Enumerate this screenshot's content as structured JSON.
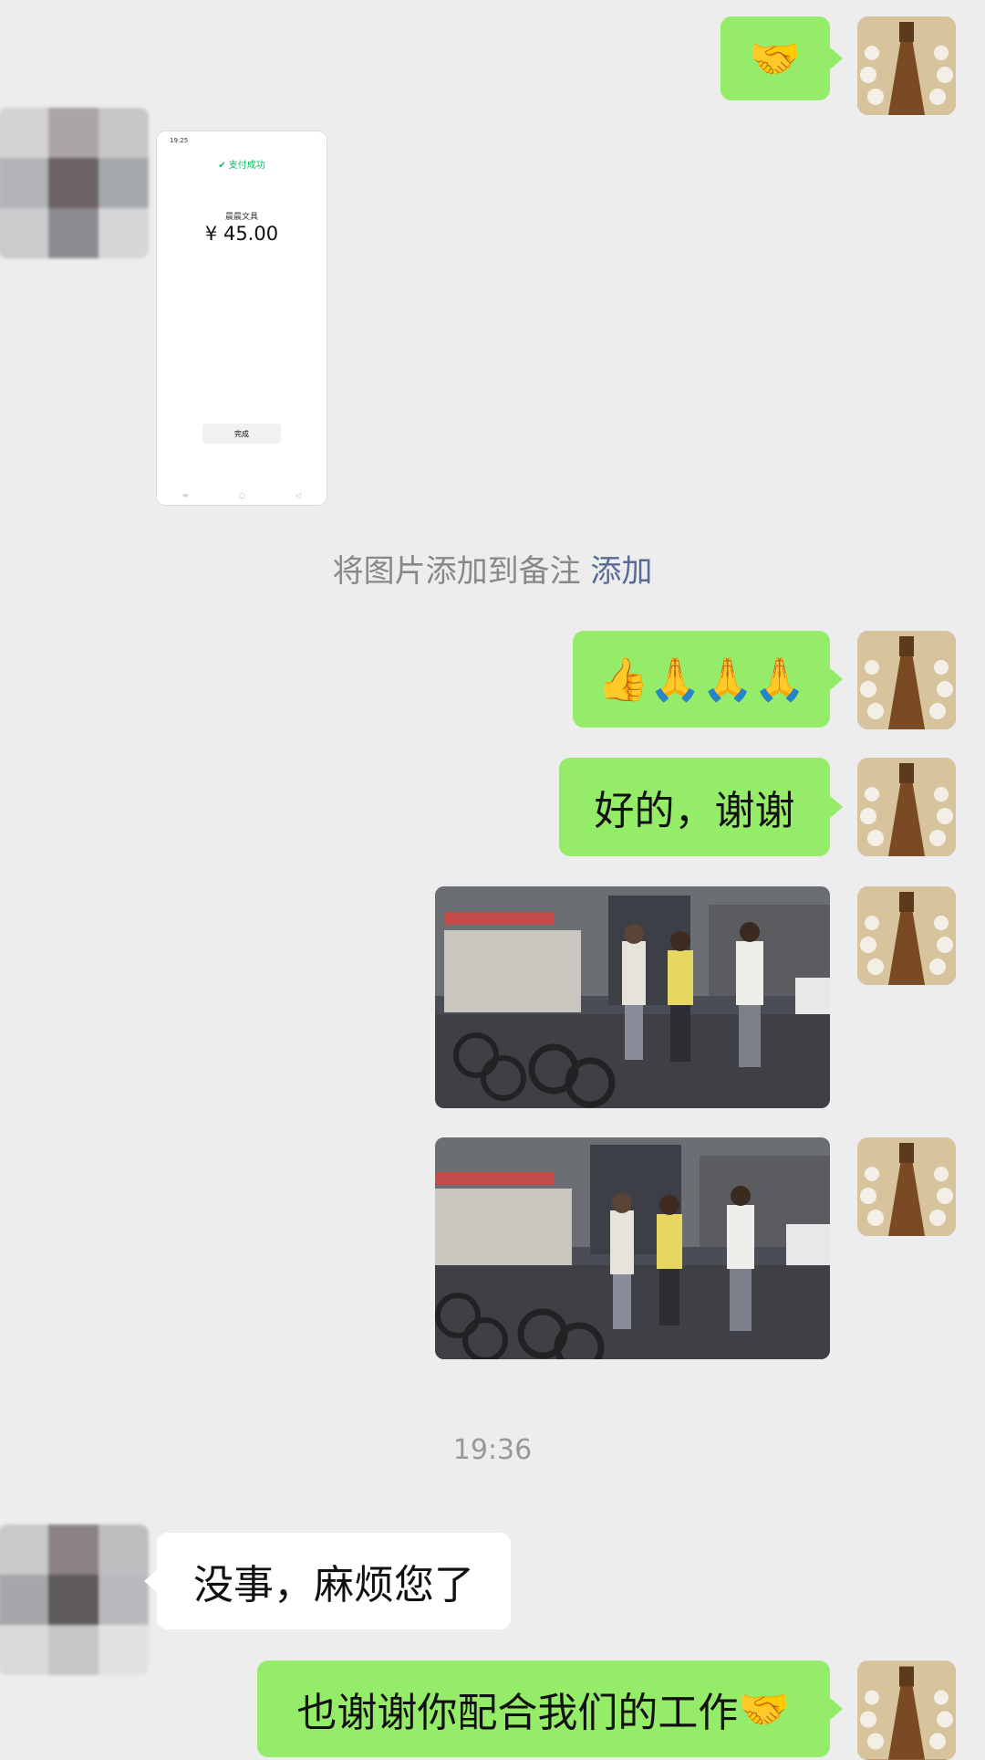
{
  "messages": {
    "m1_emoji": "🤝",
    "payment": {
      "status_time": "19:25",
      "success_label": "支付成功",
      "merchant": "晨晨文具",
      "amount": "¥ 45.00",
      "done_button": "完成",
      "nav_icons": [
        "≡",
        "○",
        "◁"
      ]
    },
    "note_hint": "将图片添加到备注",
    "note_link": "添加",
    "m3_emojis": "👍🙏🙏🙏",
    "m4_text": "好的，谢谢",
    "timestamp": "19:36",
    "m7_text": "没事，麻烦您了",
    "m8_text": "也谢谢你配合我们的工作",
    "m8_emoji": "🤝"
  },
  "colors": {
    "background": "#EDEDED",
    "bubble_self": "#95EC69",
    "bubble_other": "#FFFFFF",
    "link": "#576B95",
    "pay_success": "#07C160"
  },
  "icons": [
    "self-avatar",
    "contact-avatar",
    "check-icon",
    "handshake-emoji",
    "thumbs-up-emoji",
    "praying-hands-emoji"
  ]
}
